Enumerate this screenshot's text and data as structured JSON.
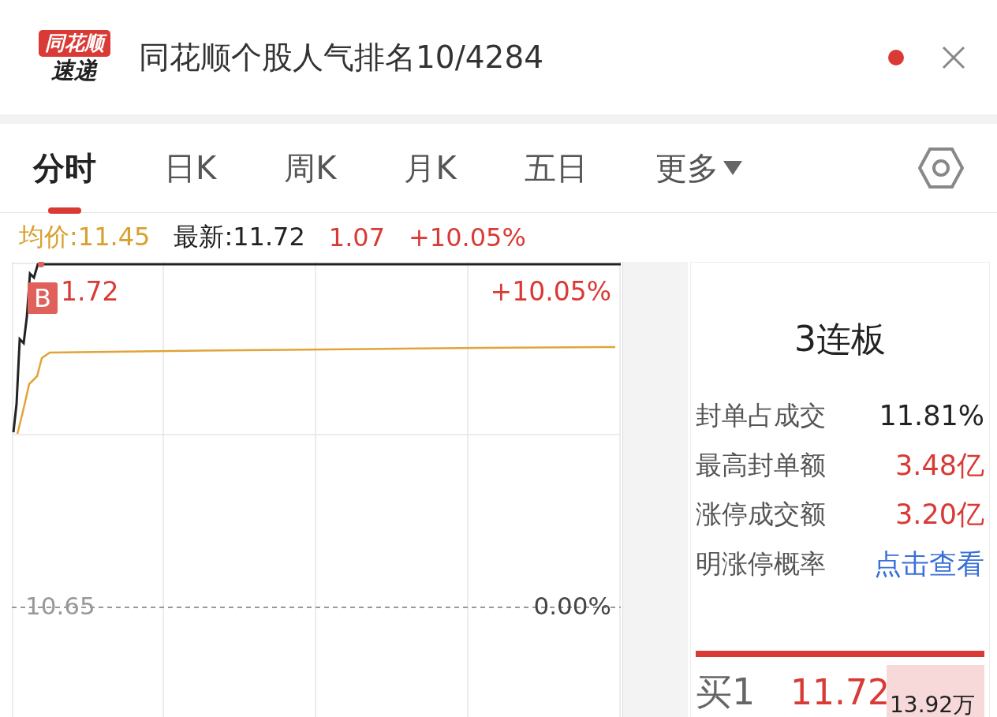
{
  "header": {
    "logo_top": "同花顺",
    "logo_bottom": "速递",
    "title": "同花顺个股人气排名10/4284",
    "unread": true
  },
  "tabs": [
    {
      "label": "分时",
      "selected": true
    },
    {
      "label": "日K",
      "selected": false
    },
    {
      "label": "周K",
      "selected": false
    },
    {
      "label": "月K",
      "selected": false
    },
    {
      "label": "五日",
      "selected": false
    },
    {
      "label": "更多",
      "selected": false,
      "kind": "dropdown"
    }
  ],
  "quote": {
    "average": "均价:11.45",
    "latest": "最新:11.72",
    "change": "1.07",
    "change_pct": "+10.05%"
  },
  "chart": {
    "high_price": "1.72",
    "high_pct": "+10.05%",
    "base_price": "10.65",
    "base_pct": "0.00%",
    "marker": "B"
  },
  "panel": {
    "title": "3连板",
    "rows": [
      {
        "label": "封单占成交",
        "value": "11.81%",
        "kind": "plain"
      },
      {
        "label": "最高封单额",
        "value": "3.48亿",
        "kind": "up"
      },
      {
        "label": "涨停成交额",
        "value": "3.20亿",
        "kind": "up"
      },
      {
        "label": "明涨停概率",
        "value": "点击查看",
        "kind": "link"
      }
    ],
    "bid": {
      "label": "买1",
      "price": "11.72",
      "volume": "13.92万"
    }
  }
}
